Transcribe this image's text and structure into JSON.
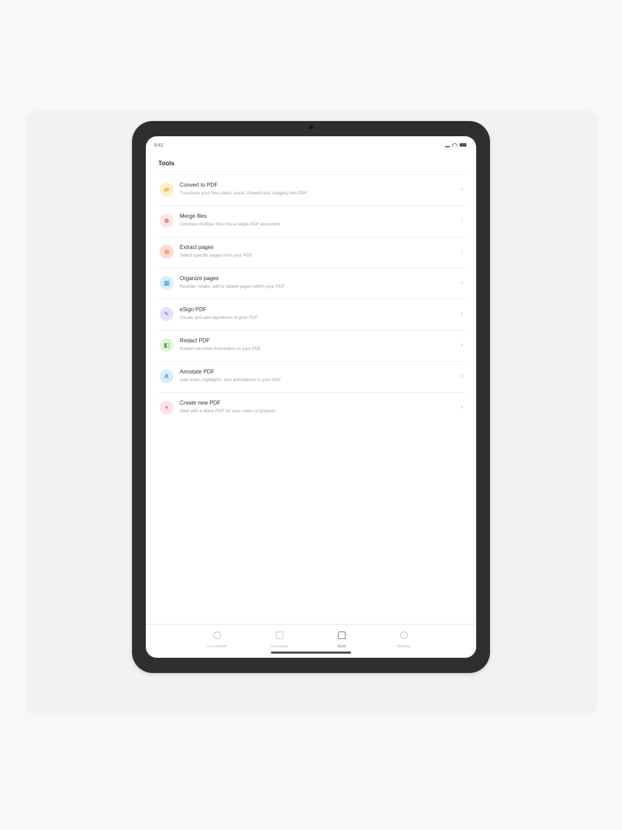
{
  "status": {
    "time": "9:41"
  },
  "page": {
    "title": "Tools"
  },
  "tools": [
    {
      "title": "Convert to PDF",
      "subtitle": "Transform your files (docx, excel, PowerPoint, images) into PDF",
      "icon": "convert-icon",
      "glyph": "⇄",
      "bg": "#fcefc7",
      "fg": "#d9a520"
    },
    {
      "title": "Merge files",
      "subtitle": "Combine multiple files into a single PDF document",
      "icon": "merge-icon",
      "glyph": "⊕",
      "bg": "#fde4e6",
      "fg": "#d8505e"
    },
    {
      "title": "Extract pages",
      "subtitle": "Select specific pages from your PDF",
      "icon": "extract-icon",
      "glyph": "⊖",
      "bg": "#fdd9d0",
      "fg": "#e06848"
    },
    {
      "title": "Organize pages",
      "subtitle": "Reorder, rotate, add or delete pages within your PDF",
      "icon": "organize-icon",
      "glyph": "▦",
      "bg": "#d6eef8",
      "fg": "#3a98c8"
    },
    {
      "title": "eSign PDF",
      "subtitle": "Create and add signatures to your PDF",
      "icon": "esign-icon",
      "glyph": "✎",
      "bg": "#e4e2fb",
      "fg": "#6b64d8"
    },
    {
      "title": "Redact PDF",
      "subtitle": "Redact sensitive information in your PDF",
      "icon": "redact-icon",
      "glyph": "◧",
      "bg": "#e2f4d8",
      "fg": "#5aa83c"
    },
    {
      "title": "Annotate PDF",
      "subtitle": "Add notes, highlights, and annotations to your PDF",
      "icon": "annotate-icon",
      "glyph": "A",
      "bg": "#d8edf8",
      "fg": "#3f9ad0"
    },
    {
      "title": "Create new PDF",
      "subtitle": "Start with a blank PDF for your notes or projects",
      "icon": "create-icon",
      "glyph": "+",
      "bg": "#fde2e8",
      "fg": "#d85a78"
    }
  ],
  "tabs": [
    {
      "label": "Documents",
      "icon": "documents-icon",
      "active": false
    },
    {
      "label": "Favourites",
      "icon": "favourites-icon",
      "active": false
    },
    {
      "label": "Tools",
      "icon": "tools-icon",
      "active": true
    },
    {
      "label": "Settings",
      "icon": "settings-icon",
      "active": false
    }
  ]
}
